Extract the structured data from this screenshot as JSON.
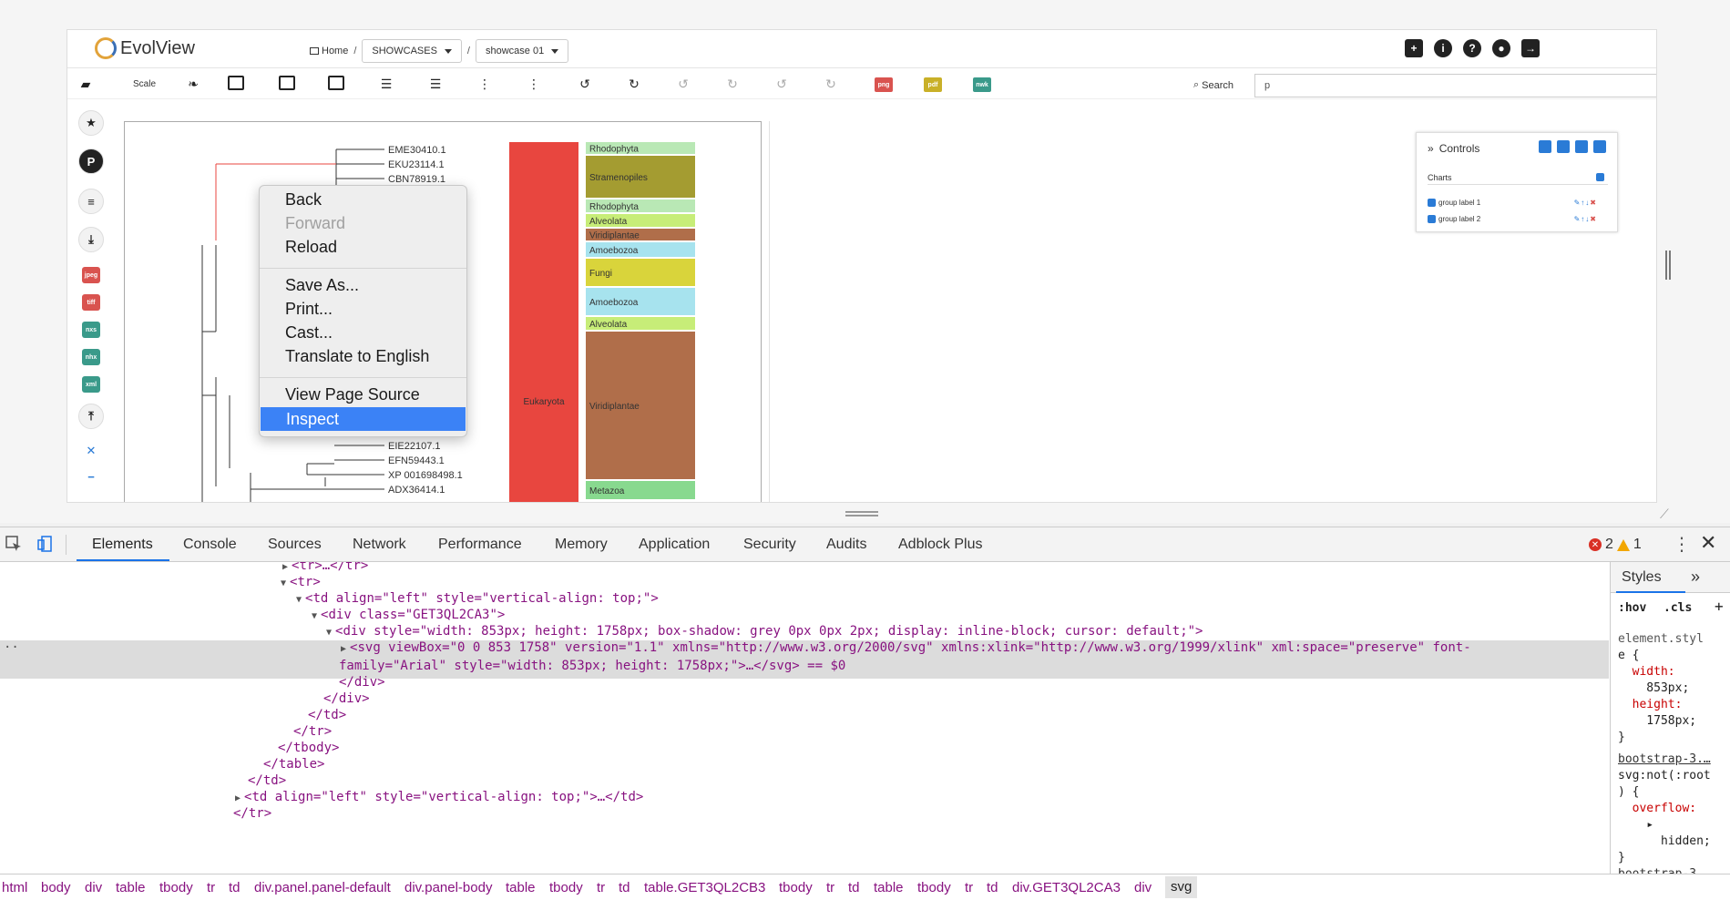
{
  "app": {
    "name": "EvolView"
  },
  "breadcrumb": {
    "home": "Home",
    "sep": "/",
    "showcases": "SHOWCASES",
    "showcase": "showcase 01"
  },
  "toolbar": {
    "scale": "Scale",
    "search_label": "Search",
    "search_value": "p",
    "png": "png",
    "pdf": "pdf",
    "nwk": "nwk"
  },
  "left_formats": {
    "jpeg": "jpeg",
    "tiff": "tiff",
    "nexus": "nxs",
    "nhx": "nhx",
    "xml": "xml"
  },
  "tree": {
    "leaves_top": [
      "EME30410.1",
      "EKU23114.1",
      "CBN78919.1"
    ],
    "leaves_bottom": [
      "EIE22107.1",
      "EFN59443.1",
      "XP 001698498.1",
      "ADX36414.1"
    ],
    "domain_label": "Eukaryota",
    "domain_color": "#e8463f",
    "groups": [
      {
        "label": "Rhodophyta",
        "color": "#b9e8b5",
        "h": 13
      },
      {
        "label": "Stramenopiles",
        "color": "#a49c31",
        "h": 46
      },
      {
        "label": "Rhodophyta",
        "color": "#b9e8b5",
        "h": 14
      },
      {
        "label": "Alveolata",
        "color": "#c7ed78",
        "h": 14
      },
      {
        "label": "Viridiplantae",
        "color": "#b06e4a",
        "h": 13
      },
      {
        "label": "Amoebozoa",
        "color": "#a7e3ee",
        "h": 16
      },
      {
        "label": "Fungi",
        "color": "#d9d43b",
        "h": 30
      },
      {
        "label": "Amoebozoa",
        "color": "#a7e3ee",
        "h": 30
      },
      {
        "label": "Alveolata",
        "color": "#c7ed78",
        "h": 14
      },
      {
        "label": "Viridiplantae",
        "color": "#b06e4a",
        "h": 162
      },
      {
        "label": "Metazoa",
        "color": "#88d98f",
        "h": 20
      }
    ]
  },
  "controls": {
    "title": "Controls",
    "charts_label": "Charts",
    "rows": [
      {
        "label": "group label 1"
      },
      {
        "label": "group label 2"
      }
    ]
  },
  "context_menu": {
    "items": [
      "Back",
      "Forward",
      "Reload",
      "Save As...",
      "Print...",
      "Cast...",
      "Translate to English",
      "View Page Source",
      "Inspect"
    ],
    "disabled": "Forward",
    "selected": "Inspect"
  },
  "devtools": {
    "tabs": [
      "Elements",
      "Console",
      "Sources",
      "Network",
      "Performance",
      "Memory",
      "Application",
      "Security",
      "Audits",
      "Adblock Plus"
    ],
    "errors": "2",
    "warnings": "1",
    "styles_tab": "Styles",
    "hov": ":hov",
    "cls": ".cls",
    "code": [
      "<tr>…</tr>",
      "<tr>",
      "<td align=\"left\" style=\"vertical-align: top;\">",
      "<div class=\"GET3QL2CA3\">",
      "<div style=\"width: 853px; height: 1758px; box-shadow: grey 0px 0px 2px; display: inline-block; cursor: default;\">",
      "<svg viewBox=\"0 0 853 1758\" version=\"1.1\" xmlns=\"http://www.w3.org/2000/svg\" xmlns:xlink=\"http://www.w3.org/1999/xlink\" xml:space=\"preserve\" font-",
      "family=\"Arial\" style=\"width: 853px; height: 1758px;\">…</svg> == $0",
      "</div>",
      "</div>",
      "</td>",
      "</tr>",
      "</tbody>",
      "</table>",
      "</td>",
      "<td align=\"left\" style=\"vertical-align: top;\">…</td>",
      "</tr>"
    ],
    "styles": [
      "element.styl",
      "e {",
      "  width:",
      "    853px;",
      "  height:",
      "    1758px;",
      "}",
      "bootstrap-3.…",
      "svg:not(:root",
      ") {",
      "  overflow:",
      "    ▸",
      "      hidden;",
      "}",
      "bootstrap-3.…"
    ],
    "breadcrumbs": [
      "html",
      "body",
      "div",
      "table",
      "tbody",
      "tr",
      "td",
      "div.panel.panel-default",
      "div.panel-body",
      "table",
      "tbody",
      "tr",
      "td",
      "table.GET3QL2CB3",
      "tbody",
      "tr",
      "td",
      "table",
      "tbody",
      "tr",
      "td",
      "div.GET3QL2CA3",
      "div",
      "svg"
    ]
  }
}
